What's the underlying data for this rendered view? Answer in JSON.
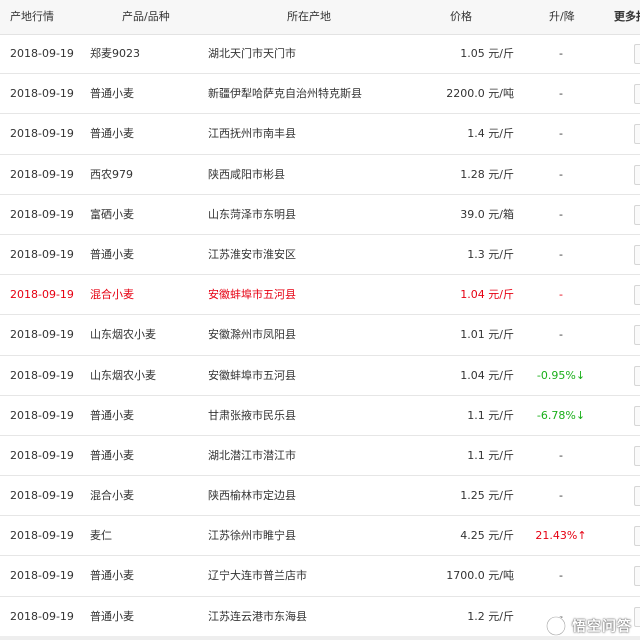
{
  "header": {
    "region": "产地行情",
    "variety": "产品/品种",
    "place": "所在产地",
    "price": "价格",
    "change": "升/降",
    "more": "更多报"
  },
  "rows": [
    {
      "date": "2018-09-19",
      "variety": "郑麦9023",
      "place": "湖北天门市天门市",
      "price": "1.05 元/斤",
      "change": "-"
    },
    {
      "date": "2018-09-19",
      "variety": "普通小麦",
      "place": "新疆伊犁哈萨克自治州特克斯县",
      "price": "2200.0 元/吨",
      "change": "-"
    },
    {
      "date": "2018-09-19",
      "variety": "普通小麦",
      "place": "江西抚州市南丰县",
      "price": "1.4 元/斤",
      "change": "-"
    },
    {
      "date": "2018-09-19",
      "variety": "西农979",
      "place": "陕西咸阳市彬县",
      "price": "1.28 元/斤",
      "change": "-"
    },
    {
      "date": "2018-09-19",
      "variety": "富硒小麦",
      "place": "山东菏泽市东明县",
      "price": "39.0 元/箱",
      "change": "-"
    },
    {
      "date": "2018-09-19",
      "variety": "普通小麦",
      "place": "江苏淮安市淮安区",
      "price": "1.3 元/斤",
      "change": "-"
    },
    {
      "date": "2018-09-19",
      "variety": "混合小麦",
      "place": "安徽蚌埠市五河县",
      "price": "1.04 元/斤",
      "change": "-",
      "highlight": true
    },
    {
      "date": "2018-09-19",
      "variety": "山东烟农小麦",
      "place": "安徽滁州市凤阳县",
      "price": "1.01 元/斤",
      "change": "-"
    },
    {
      "date": "2018-09-19",
      "variety": "山东烟农小麦",
      "place": "安徽蚌埠市五河县",
      "price": "1.04 元/斤",
      "change": "-0.95%↓",
      "trend": "down"
    },
    {
      "date": "2018-09-19",
      "variety": "普通小麦",
      "place": "甘肃张掖市民乐县",
      "price": "1.1 元/斤",
      "change": "-6.78%↓",
      "trend": "down"
    },
    {
      "date": "2018-09-19",
      "variety": "普通小麦",
      "place": "湖北潜江市潜江市",
      "price": "1.1 元/斤",
      "change": "-"
    },
    {
      "date": "2018-09-19",
      "variety": "混合小麦",
      "place": "陕西榆林市定边县",
      "price": "1.25 元/斤",
      "change": "-"
    },
    {
      "date": "2018-09-19",
      "variety": "麦仁",
      "place": "江苏徐州市睢宁县",
      "price": "4.25 元/斤",
      "change": "21.43%↑",
      "trend": "up"
    },
    {
      "date": "2018-09-19",
      "variety": "普通小麦",
      "place": "辽宁大连市普兰店市",
      "price": "1700.0 元/吨",
      "change": "-"
    },
    {
      "date": "2018-09-19",
      "variety": "普通小麦",
      "place": "江苏连云港市东海县",
      "price": "1.2 元/斤",
      "change": "-"
    }
  ],
  "watermark": {
    "text": "悟空问答",
    "icon": "wukong-logo-icon"
  },
  "colors": {
    "highlight": "#e60012",
    "down": "#1aaf1a",
    "up": "#e60012",
    "header_bg": "#f7f7f7"
  }
}
